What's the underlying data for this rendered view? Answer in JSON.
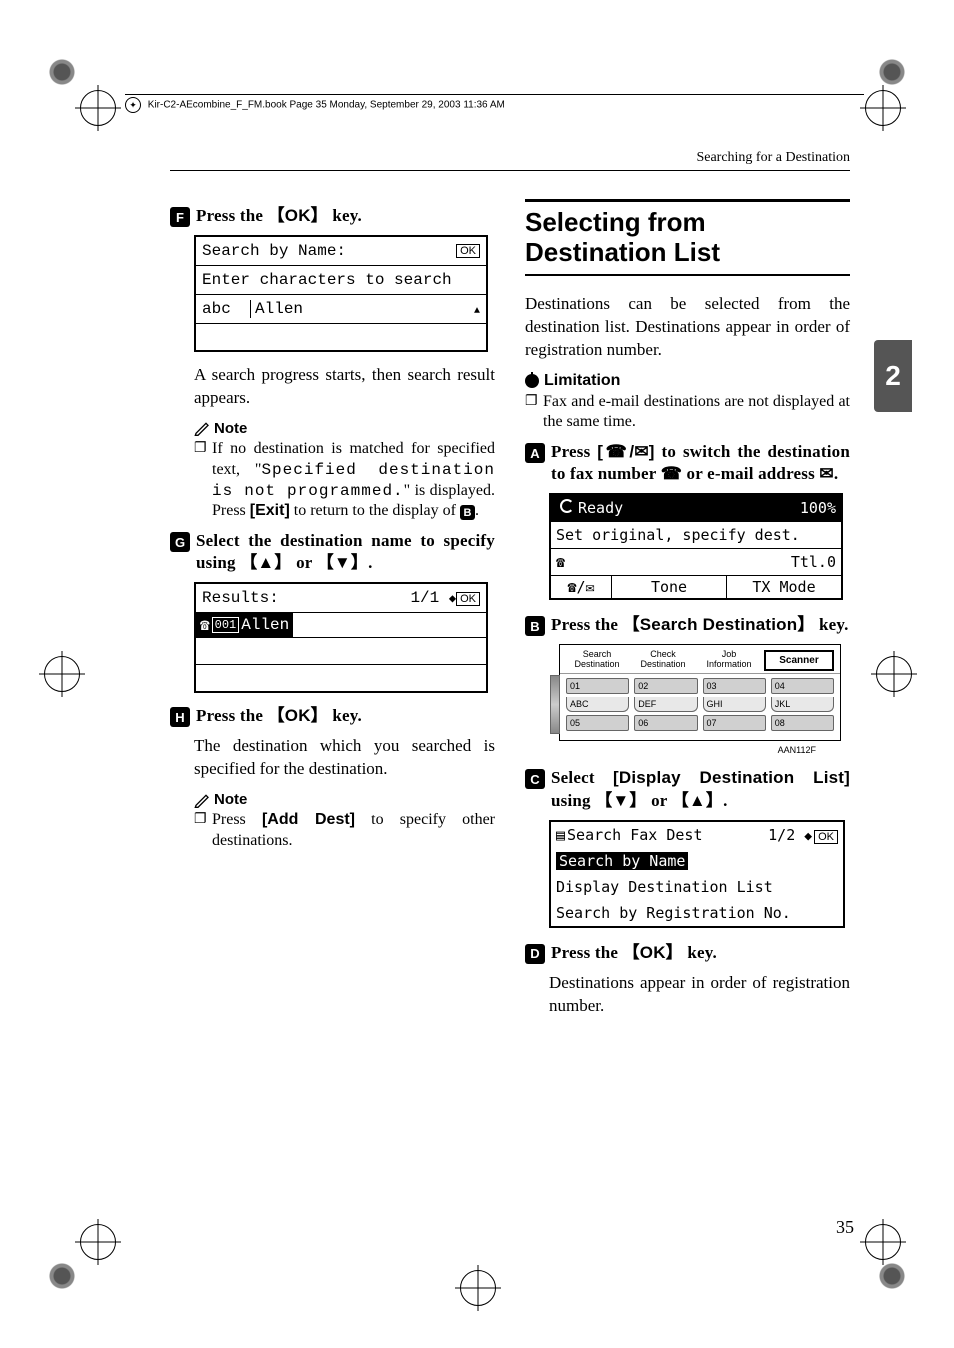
{
  "header_line": "Kir-C2-AEcombine_F_FM.book  Page 35  Monday, September 29, 2003  11:36 AM",
  "running_head": "Searching for a Destination",
  "side_tab": "2",
  "page_number": "35",
  "left": {
    "step6": {
      "num": "F",
      "text_a": "Press the ",
      "key": "OK",
      "text_b": " key."
    },
    "lcd1": {
      "r1_left": "Search by Name:",
      "r1_right": "OK",
      "r2": "Enter characters to search",
      "r3_left": "abc",
      "r3_mid": "Allen"
    },
    "p1": "A search progress starts, then search result appears.",
    "note_label": "Note",
    "note1_a": "If no destination is matched for specified text, \"",
    "note1_mono": "Specified destination is not programmed.",
    "note1_b": "\" is displayed. Press ",
    "note1_key": "[Exit]",
    "note1_c": " to return to the display of ",
    "note1_ref": "B",
    "note1_d": ".",
    "step7": {
      "num": "G",
      "text_a": "Select the destination name to specify using ",
      "k1": "【▲】",
      "mid": " or ",
      "k2": "【▼】",
      "end": "."
    },
    "lcd2": {
      "r1_left": "Results:",
      "r1_right": "1/1",
      "r1_ok": "OK",
      "r2_badge": "001",
      "r2_name": "Allen"
    },
    "step8": {
      "num": "H",
      "text_a": "Press the ",
      "key": "OK",
      "text_b": " key."
    },
    "p2": "The destination which you searched is specified for the destination.",
    "note2_a": "Press ",
    "note2_key": "[Add Dest]",
    "note2_b": " to specify other destinations."
  },
  "right": {
    "h2": "Selecting from Destination List",
    "intro": "Destinations can be selected from the destination list. Destinations appear in order of registration number.",
    "limitation_label": "Limitation",
    "lim1": "Fax and e-mail destinations are not displayed at the same time.",
    "step1": {
      "num": "A",
      "a": "Press ",
      "k": "[      ]",
      "b": " to switch the destination to fax number ",
      "c": " or e-mail address ",
      "d": "."
    },
    "lcd_ready": {
      "r1_left": "Ready",
      "r1_right": "100%",
      "r2": "Set original, specify dest.",
      "r3_right": "Ttl.0",
      "r4_b": "Tone",
      "r4_c": "TX Mode"
    },
    "step2": {
      "num": "B",
      "a": "Press the ",
      "key": "Search Destination",
      "b": " key."
    },
    "panel": {
      "tabs": [
        "Search Destination",
        "Check Destination",
        "Job Information",
        "Scanner"
      ],
      "keys_row1": [
        "01",
        "02",
        "03",
        "04"
      ],
      "keys_row2": [
        "ABC",
        "DEF",
        "GHI",
        "JKL"
      ],
      "keys_row3": [
        "05",
        "06",
        "07",
        "08"
      ],
      "fig_id": "AAN112F"
    },
    "step3": {
      "num": "C",
      "a": "Select ",
      "key": "[Display Destination List]",
      "b": " using ",
      "k1": "【▼】",
      "mid": " or ",
      "k2": "【▲】",
      "end": "."
    },
    "lcd_menu": {
      "r1_left": "Search Fax Dest",
      "r1_mid": "1/2",
      "r1_ok": "OK",
      "r2": "Search by Name",
      "r3": "Display Destination List",
      "r4": "Search by Registration No."
    },
    "step4": {
      "num": "D",
      "a": "Press the ",
      "key": "OK",
      "b": " key."
    },
    "p_end": "Destinations appear in order of registration number."
  }
}
